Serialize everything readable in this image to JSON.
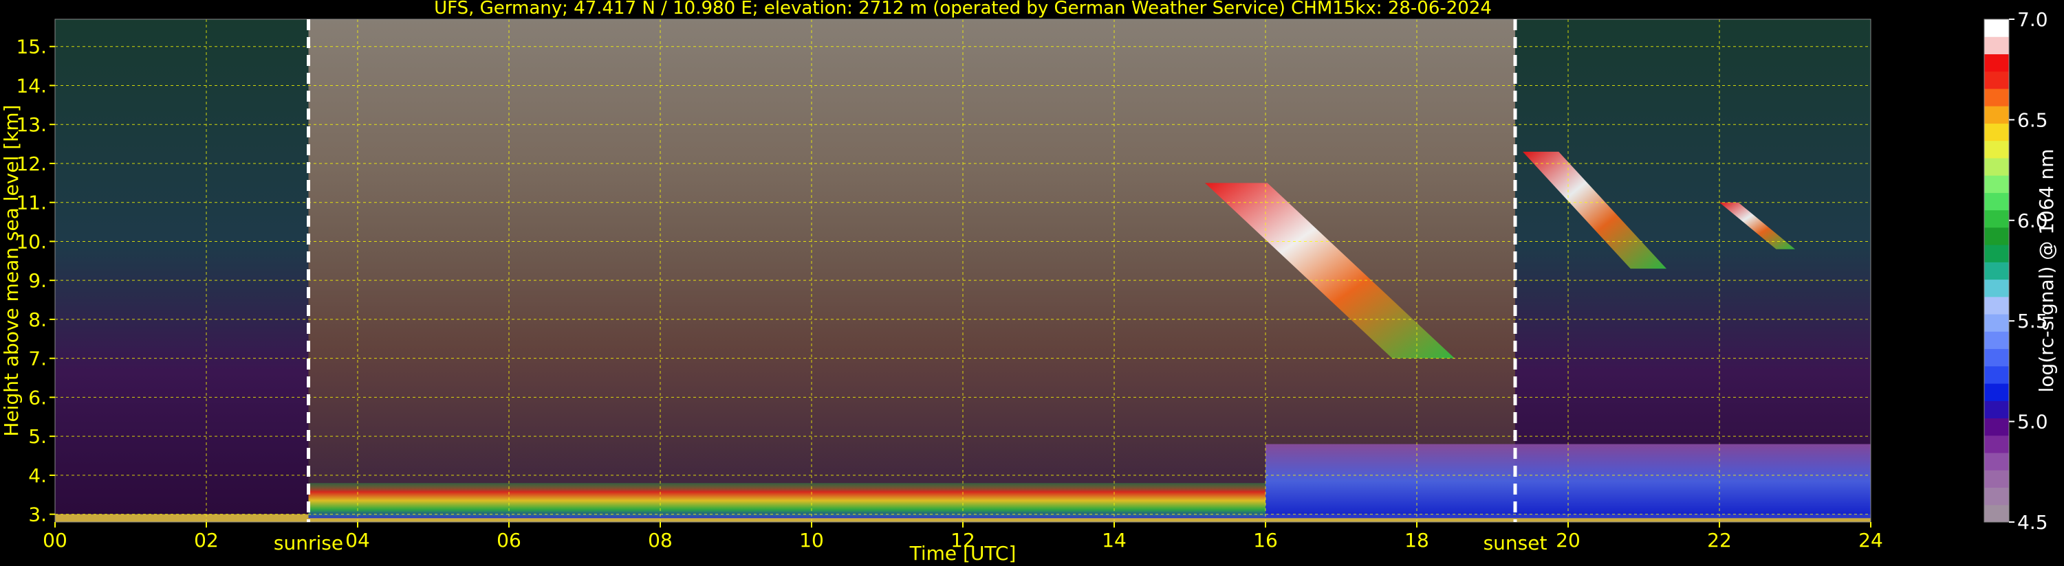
{
  "chart_data": {
    "type": "heatmap",
    "title": "UFS, Germany; 47.417 N / 10.980 E; elevation: 2712 m  (operated by German Weather Service)    CHM15kx: 28-06-2024",
    "xlabel": "Time [UTC]",
    "ylabel": "Height above mean sea level [km]",
    "xlim": [
      0,
      24
    ],
    "ylim": [
      2.8,
      15.7
    ],
    "x_ticks": [
      "00",
      "02",
      "04",
      "06",
      "08",
      "10",
      "12",
      "14",
      "16",
      "18",
      "20",
      "22",
      "24"
    ],
    "x_tick_values": [
      0,
      2,
      4,
      6,
      8,
      10,
      12,
      14,
      16,
      18,
      20,
      22,
      24
    ],
    "y_ticks": [
      "3.",
      "4.",
      "5.",
      "6.",
      "7.",
      "8.",
      "9.",
      "10.",
      "11.",
      "12.",
      "13.",
      "14.",
      "15."
    ],
    "y_tick_values": [
      3,
      4,
      5,
      6,
      7,
      8,
      9,
      10,
      11,
      12,
      13,
      14,
      15
    ],
    "grid": true,
    "colorbar": {
      "label": "log(rc-signal) @ 1064 nm",
      "range": [
        4.5,
        7.0
      ],
      "ticks": [
        "4.5",
        "5.0",
        "5.5",
        "6.0",
        "6.5",
        "7.0"
      ],
      "tick_values": [
        4.5,
        5.0,
        5.5,
        6.0,
        6.5,
        7.0
      ],
      "colors": [
        "#a08fa0",
        "#a07fa8",
        "#9a6aa8",
        "#8f50a8",
        "#7a2a9a",
        "#5a0a8a",
        "#2a10b0",
        "#0a20e0",
        "#2a4af0",
        "#4a6af6",
        "#6a8afa",
        "#8aaafa",
        "#aac0fa",
        "#5ec8d8",
        "#20b090",
        "#10a050",
        "#1c9c2c",
        "#30c040",
        "#50e060",
        "#80f070",
        "#b8f060",
        "#e8f040",
        "#f8d820",
        "#f8a818",
        "#f86818",
        "#f02818",
        "#f01010",
        "#f8c8c8",
        "#ffffff"
      ]
    },
    "events": [
      {
        "label": "sunrise",
        "x": 3.35
      },
      {
        "label": "sunset",
        "x": 19.3
      }
    ],
    "layers": [
      {
        "name": "ground",
        "x": [
          0,
          24
        ],
        "y": [
          2.8,
          3.0
        ]
      },
      {
        "name": "boundary layer",
        "x": [
          3.35,
          16.0
        ],
        "y": [
          2.9,
          3.8
        ]
      },
      {
        "name": "residual layer",
        "x": [
          16.0,
          24
        ],
        "y": [
          2.9,
          4.8
        ]
      },
      {
        "name": "cirrus",
        "x": [
          15.2,
          18.5
        ],
        "y": [
          7.0,
          11.5
        ]
      },
      {
        "name": "cirrus",
        "x": [
          19.4,
          21.3
        ],
        "y": [
          9.3,
          12.3
        ]
      },
      {
        "name": "cirrus",
        "x": [
          22.0,
          23.0
        ],
        "y": [
          9.8,
          11.0
        ]
      }
    ]
  }
}
